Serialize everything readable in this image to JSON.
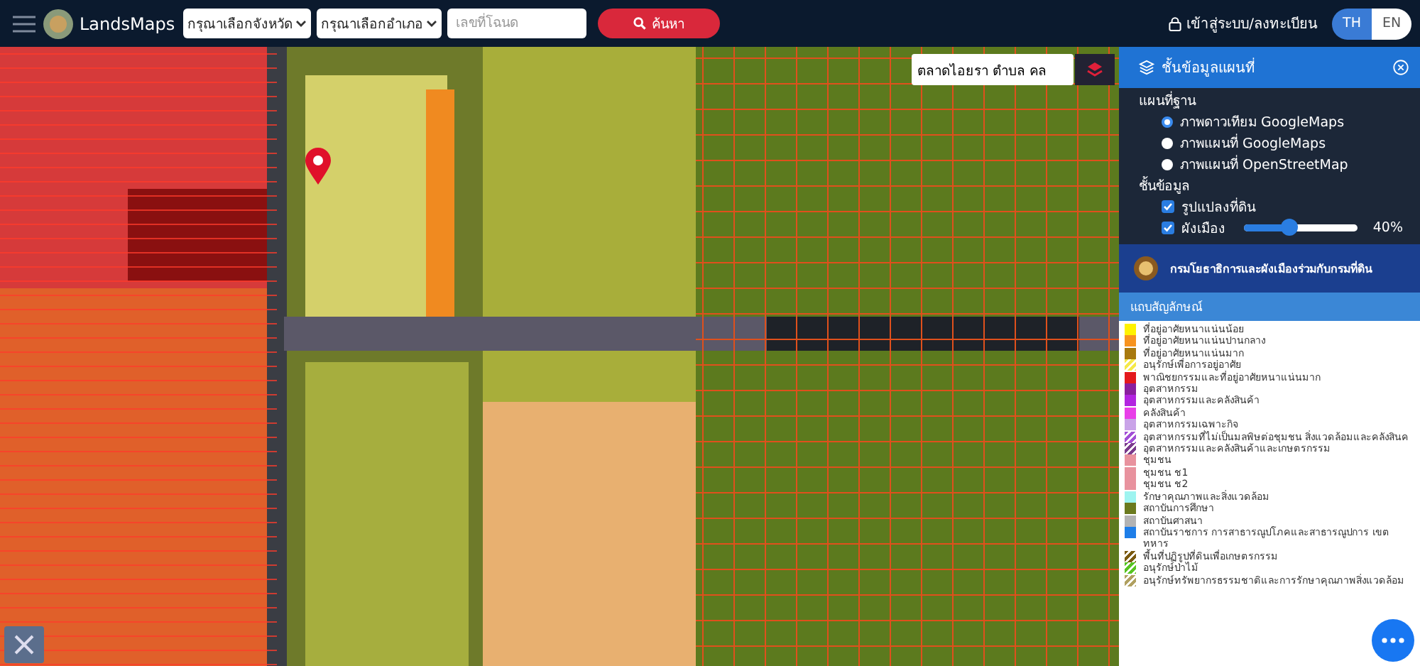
{
  "topbar": {
    "brand": "LandsMaps",
    "province_select": "กรุณาเลือกจังหวัด",
    "district_select": "กรุณาเลือกอำเภอ",
    "deed_field": {
      "placeholder": "เลขที่โฉนด"
    },
    "search_button": "ค้นหา",
    "login_link": "เข้าสู่ระบบ/ลงทะเบียน",
    "languages": [
      {
        "label": "TH",
        "selected": true
      },
      {
        "label": "EN",
        "selected": false
      }
    ]
  },
  "map": {
    "search_field": {
      "value": "ตลาดไอยรา ตำบล คล"
    }
  },
  "layer_panel": {
    "title": "ชั้นข้อมูลแผนที่",
    "base_map_heading": "แผนที่ฐาน",
    "base_maps": [
      {
        "label": "ภาพดาวเทียม GoogleMaps",
        "selected": true
      },
      {
        "label": "ภาพแผนที่ GoogleMaps",
        "selected": false
      },
      {
        "label": "ภาพแผนที่ OpenStreetMap",
        "selected": false
      }
    ],
    "layers_heading": "ชั้นข้อมูล",
    "layers": [
      {
        "kind": "checkbox",
        "label": "รูปแปลงที่ดิน",
        "checked": true
      },
      {
        "kind": "slider",
        "label": "ผังเมือง",
        "checked": true,
        "level": 0.4,
        "reading": "40%"
      }
    ],
    "banner": "กรมโยธาธิการและผังเมืองร่วมกับกรมที่ดิน",
    "legend_heading": "แถบสัญลักษณ์",
    "legend": [
      {
        "kind": "solid",
        "label": "ที่อยู่อาศัยหนาแน่นน้อย",
        "color": "#fff200"
      },
      {
        "kind": "solid",
        "label": "ที่อยู่อาศัยหนาแน่นปานกลาง",
        "color": "#f7931e"
      },
      {
        "kind": "solid",
        "label": "ที่อยู่อาศัยหนาแน่นมาก",
        "color": "#a8790e"
      },
      {
        "kind": "striped",
        "label": "อนุรักษ์เพื่อการอยู่อาศัย",
        "color": "#f5e94a"
      },
      {
        "kind": "solid",
        "label": "พาณิชยกรรมและที่อยู่อาศัยหนาแน่นมาก",
        "color": "#e3191c"
      },
      {
        "kind": "solid",
        "label": "อุตสาหกรรม",
        "color": "#8a1f9e"
      },
      {
        "kind": "solid",
        "label": "อุตสาหกรรมและคลังสินค้า",
        "color": "#b224e0"
      },
      {
        "kind": "solid",
        "label": "คลังสินค้า",
        "color": "#e83ee8"
      },
      {
        "kind": "solid",
        "label": "อุตสาหกรรมเฉพาะกิจ",
        "color": "#c9a3e8"
      },
      {
        "kind": "striped",
        "label": "อุตสาหกรรมที่ไม่เป็นมลพิษต่อชุมชน สิ่งแวดล้อมและคลังสินค",
        "color": "#a24fd6"
      },
      {
        "kind": "striped",
        "label": "อุตสาหกรรมและคลังสินค้าและเกษตรกรรม",
        "color": "#7a3a8c"
      },
      {
        "kind": "solid",
        "label": "ชุมชน",
        "color": "#e8929e"
      },
      {
        "kind": "solid",
        "label": "ชุมชน ช1",
        "color": "#e8929e"
      },
      {
        "kind": "solid",
        "label": "ชุมชน ช2",
        "color": "#e8929e"
      },
      {
        "kind": "solid",
        "label": "รักษาคุณภาพและสิ่งแวดล้อม",
        "color": "#9ef4f0"
      },
      {
        "kind": "solid",
        "label": "สถาบันการศึกษา",
        "color": "#6b7a1e"
      },
      {
        "kind": "solid",
        "label": "สถาบันศาสนา",
        "color": "#b3b3b3"
      },
      {
        "kind": "solid",
        "label": "สถาบันราชการ การสาธารณูปโภคและสาธารณูปการ เขตทหาร",
        "color": "#1e7ee8"
      },
      {
        "kind": "striped",
        "label": "พื้นที่ปฏิรูปที่ดินเพื่อเกษตรกรรม",
        "color": "#7a5a10"
      },
      {
        "kind": "striped",
        "label": "อนุรักษ์ป่าไม้",
        "color": "#58c422"
      },
      {
        "kind": "striped",
        "label": "อนุรักษ์ทรัพยากรธรรมชาติและการรักษาคุณภาพสิ่งแวดล้อม",
        "color": "#b0a060"
      }
    ]
  }
}
